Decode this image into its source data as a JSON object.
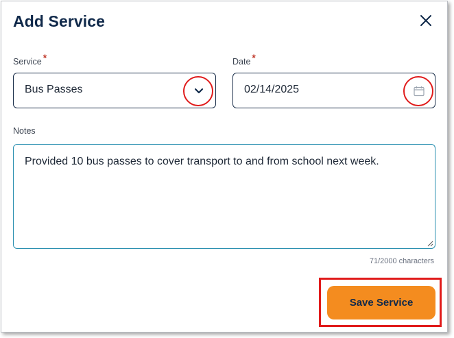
{
  "dialog": {
    "title": "Add Service",
    "close_icon": "close-icon"
  },
  "service": {
    "label": "Service",
    "required_marker": "*",
    "value": "Bus Passes",
    "toggle_icon": "chevron-down-icon"
  },
  "date": {
    "label": "Date",
    "required_marker": "*",
    "value": "02/14/2025",
    "picker_icon": "calendar-icon"
  },
  "notes": {
    "label": "Notes",
    "value": "Provided 10 bus passes to cover transport to and from school next week.",
    "counter": "71/2000 characters"
  },
  "actions": {
    "save_label": "Save Service"
  },
  "colors": {
    "title": "#10294a",
    "required": "#c0392b",
    "accent_button": "#f48c1f",
    "annotation": "#e01b1b",
    "notes_border": "#2a8fb0"
  }
}
